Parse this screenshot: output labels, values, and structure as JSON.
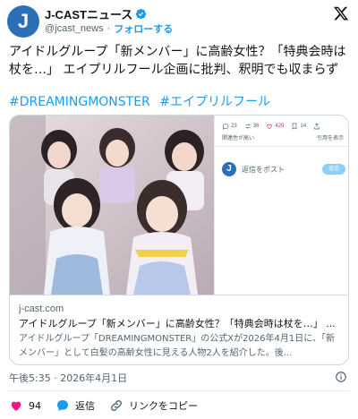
{
  "account": {
    "name": "J-CASTニュース",
    "handle": "@jcast_news",
    "separator": "·",
    "follow_label": "フォローする",
    "avatar_letter": "J"
  },
  "tweet": {
    "text": "アイドルグループ「新メンバー」に高齢女性？「特典会時は杖を…」 エイプリルフール企画に批判、釈明でも収まらず",
    "hashtags": [
      "#DREAMINGMONSTER",
      "#エイプリルフール"
    ]
  },
  "embed": {
    "stats": {
      "replies": "23",
      "reposts": "36",
      "likes": "429",
      "bookmarks": "14"
    },
    "links": {
      "left": "関連性が高い",
      "right": "引用を表示"
    },
    "reply_placeholder": "返信をポスト",
    "reply_button": "返信",
    "avatar_letter": "J"
  },
  "card": {
    "domain": "j-cast.com",
    "title": "アイドルグループ「新メンバー」に高齢女性？「特典会時は杖を…」 ...",
    "description": "アイドルグループ「DREAMINGMONSTER」の公式Xが2026年4月1日に、「新メンバー」として白髪の高齢女性に見える人物2人を紹介した。後..."
  },
  "meta": {
    "timestamp": "午後5:35 · 2026年4月1日"
  },
  "actions": {
    "like_count": "94",
    "reply_label": "返信",
    "copy_link_label": "リンクをコピー"
  },
  "colors": {
    "accent": "#1d9bf0",
    "like": "#f91880",
    "brand": "#2a6fb8"
  }
}
